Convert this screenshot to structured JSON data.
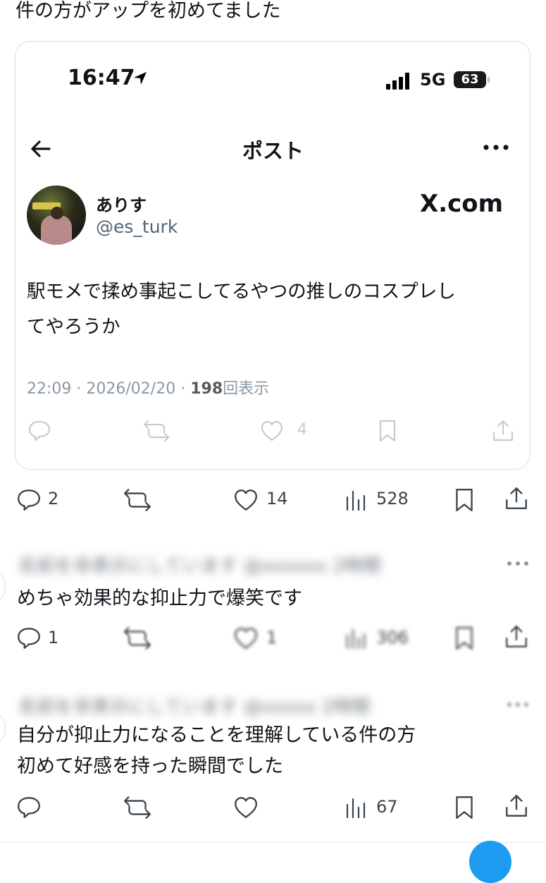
{
  "header_caption": "件の方がアップを初めてました",
  "embedded_screenshot": {
    "status_bar": {
      "time": "16:47",
      "network": "5G",
      "battery": "63"
    },
    "nav": {
      "title": "ポスト"
    },
    "author": {
      "display_name": "ありす",
      "handle": "@es_turk"
    },
    "watermark": "X.com",
    "post_text_line1": "駅モメで揉め事起こしてるやつの推しのコスプレし",
    "post_text_line2": "てやろうか",
    "meta": {
      "time": "22:09",
      "sep": "·",
      "date": "2026/02/20",
      "views_count": "198",
      "views_label": "回表示"
    },
    "actions": {
      "like_count": "4"
    }
  },
  "main_actions": {
    "reply_count": "2",
    "like_count": "14",
    "view_count": "528"
  },
  "reply1": {
    "header_blurred": "名前を非表示にしています @xxxxxx 2時間",
    "text": "めちゃ効果的な抑止力で爆笑です",
    "reply_count": "1",
    "like_count": "1",
    "view_count": "306"
  },
  "reply2": {
    "header_blurred": "名前を非表示にしています @xxxxx 2時間",
    "text_line1": "自分が抑止力になることを理解している件の方",
    "text_line2": "初めて好感を持った瞬間でした",
    "view_count": "67"
  },
  "colors": {
    "text": "#0f1419",
    "secondary": "#536471",
    "icon": "#3a444c",
    "border": "#d9dee3"
  }
}
